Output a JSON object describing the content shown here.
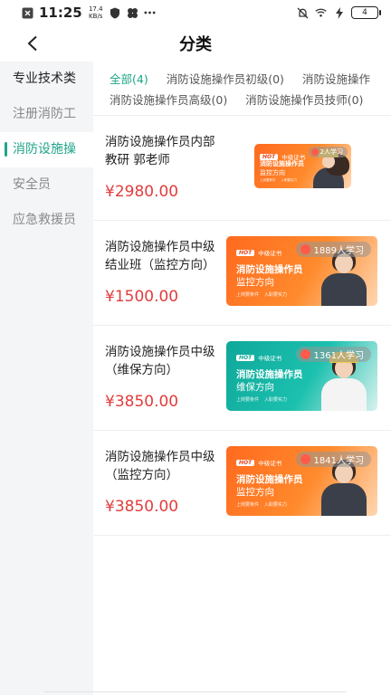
{
  "status_bar": {
    "time": "11:25",
    "net_speed_value": "17.4",
    "net_speed_unit": "KB/s",
    "battery": "4"
  },
  "nav": {
    "title": "分类"
  },
  "sidebar": {
    "header": "专业技术类",
    "items": [
      "注册消防工",
      "消防设施操",
      "安全员",
      "应急救援员"
    ],
    "active_index": 1
  },
  "filters": {
    "row1": [
      "全部(4)",
      "消防设施操作员初级(0)",
      "消防设施操作"
    ],
    "row2": [
      "消防设施操作员高级(0)",
      "消防设施操作员技师(0)"
    ]
  },
  "thumb_text": {
    "hot": "HOT",
    "level": "中级证书",
    "title": "消防设施操作员",
    "dir_monitor": "监控方向",
    "dir_maintain": "维保方向",
    "bullet1": "上岗要条件",
    "bullet2": "入职要实力"
  },
  "courses": [
    {
      "title": "消防设施操作员内部教研 郭老师",
      "price": "¥2980.00",
      "learners": "2人学习",
      "theme": "orange",
      "direction": "监控方向"
    },
    {
      "title": "消防设施操作员中级结业班（监控方向）",
      "price": "¥1500.00",
      "learners": "1889人学习",
      "theme": "orange",
      "direction": "监控方向"
    },
    {
      "title": "消防设施操作员中级（维保方向）",
      "price": "¥3850.00",
      "learners": "1361人学习",
      "theme": "teal",
      "direction": "维保方向"
    },
    {
      "title": "消防设施操作员中级（监控方向）",
      "price": "¥3850.00",
      "learners": "1841人学习",
      "theme": "orange",
      "direction": "监控方向"
    }
  ],
  "colors": {
    "accent": "#21a48a",
    "price": "#e23c3c",
    "sidebar_bg": "#f4f5f7",
    "thumb_orange": "#ff6a1f",
    "thumb_teal": "#0fa89a"
  }
}
